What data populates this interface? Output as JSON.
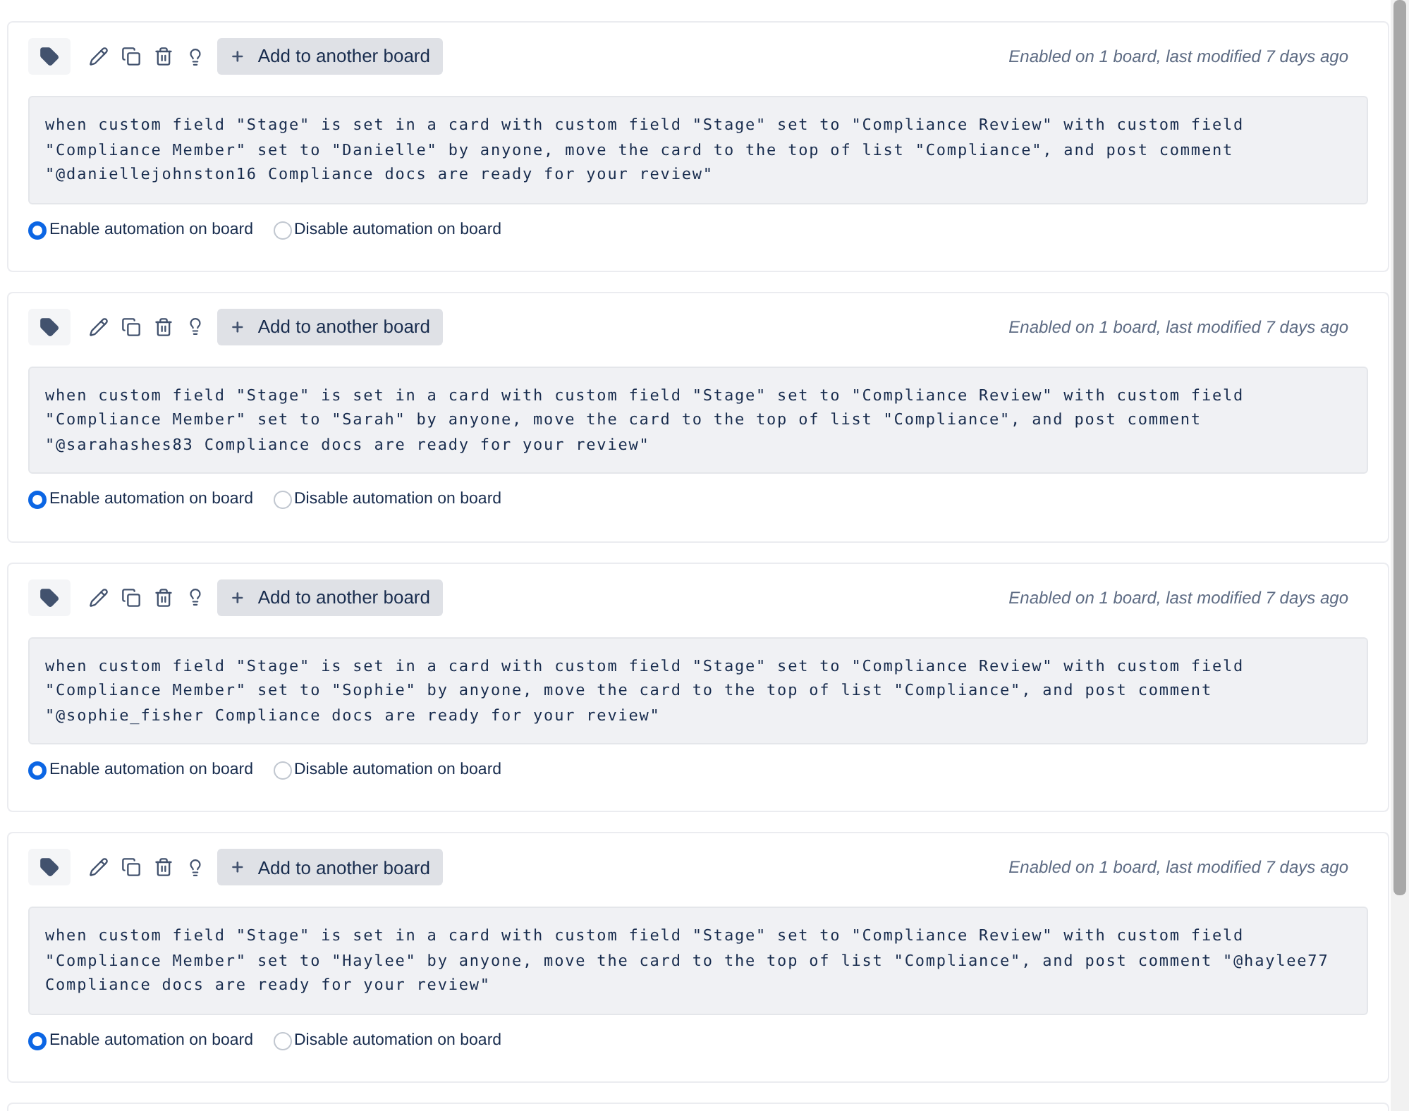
{
  "rules": [
    {
      "add_button": "Add to another board",
      "status": "Enabled on 1 board, last modified 7 days ago",
      "description": "when custom field \"Stage\" is set in a card with custom field \"Stage\" set to \"Compliance Review\" with custom field \"Compliance Member\" set to \"Danielle\" by anyone, move the card to the top of list \"Compliance\", and post comment \"@daniellejohnston16 Compliance docs are ready for your review\"",
      "options": [
        {
          "label": "Enable automation on board",
          "selected": true
        },
        {
          "label": "Disable automation on board",
          "selected": false
        }
      ]
    },
    {
      "add_button": "Add to another board",
      "status": "Enabled on 1 board, last modified 7 days ago",
      "description": "when custom field \"Stage\" is set in a card with custom field \"Stage\" set to \"Compliance Review\" with custom field \"Compliance Member\" set to \"Sarah\" by anyone, move the card to the top of list \"Compliance\", and post comment \"@sarahashes83 Compliance docs are ready for your review\"",
      "options": [
        {
          "label": "Enable automation on board",
          "selected": true
        },
        {
          "label": "Disable automation on board",
          "selected": false
        }
      ]
    },
    {
      "add_button": "Add to another board",
      "status": "Enabled on 1 board, last modified 7 days ago",
      "description": "when custom field \"Stage\" is set in a card with custom field \"Stage\" set to \"Compliance Review\" with custom field \"Compliance Member\" set to \"Sophie\" by anyone, move the card to the top of list \"Compliance\", and post comment \"@sophie_fisher Compliance docs are ready for your review\"",
      "options": [
        {
          "label": "Enable automation on board",
          "selected": true
        },
        {
          "label": "Disable automation on board",
          "selected": false
        }
      ]
    },
    {
      "add_button": "Add to another board",
      "status": "Enabled on 1 board, last modified 7 days ago",
      "description": "when custom field \"Stage\" is set in a card with custom field \"Stage\" set to \"Compliance Review\" with custom field \"Compliance Member\" set to \"Haylee\" by anyone, move the card to the top of list \"Compliance\", and post comment \"@haylee77 Compliance docs are ready for your review\"",
      "options": [
        {
          "label": "Enable automation on board",
          "selected": true
        },
        {
          "label": "Disable automation on board",
          "selected": false
        }
      ]
    }
  ],
  "more_below": true
}
